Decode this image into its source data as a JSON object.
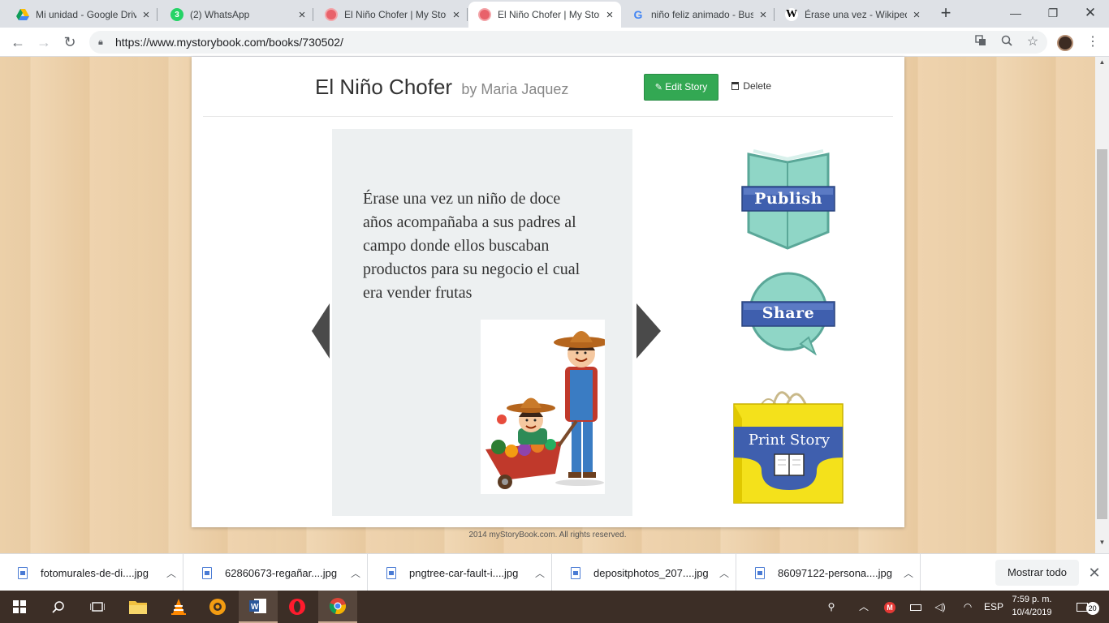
{
  "browser": {
    "tabs": [
      {
        "title": "Mi unidad - Google Drive",
        "favicon": "google-drive-icon",
        "active": false
      },
      {
        "title": "(2) WhatsApp",
        "favicon": "whatsapp-icon",
        "badge": "3",
        "active": false
      },
      {
        "title": "El Niño Chofer | My Story",
        "favicon": "mystorybook-icon",
        "active": false
      },
      {
        "title": "El Niño Chofer | My Story",
        "favicon": "mystorybook-icon",
        "active": true
      },
      {
        "title": "niño feliz animado - Buscar",
        "favicon": "google-icon",
        "active": false
      },
      {
        "title": "Érase una vez - Wikipedia",
        "favicon": "wikipedia-icon",
        "active": false
      }
    ],
    "new_tab": "+",
    "url": "https://www.mystorybook.com/books/730502/"
  },
  "story": {
    "title": "El Niño Chofer",
    "author_prefix": "by",
    "author": "Maria Jaquez",
    "edit_label": "Edit Story",
    "delete_label": "Delete",
    "page_text": "Érase una vez un niño de doce años acompañaba a sus padres al campo donde ellos buscaban productos para su negocio el cual era vender frutas",
    "actions": {
      "publish": "Publish",
      "share": "Share",
      "print": "Print Story"
    },
    "footer": "2014 myStoryBook.com. All rights reserved."
  },
  "downloads": {
    "items": [
      "fotomurales-de-di....jpg",
      "62860673-regañar....jpg",
      "pngtree-car-fault-i....jpg",
      "depositphotos_207....jpg",
      "86097122-persona....jpg"
    ],
    "show_all": "Mostrar todo"
  },
  "taskbar": {
    "language": "ESP",
    "time": "7:59 p. m.",
    "date": "10/4/2019",
    "notifications": "20"
  },
  "colors": {
    "edit_button": "#33a853",
    "publish_teal": "#78c8b8",
    "ribbon_blue": "#3f5fae",
    "print_yellow": "#f4e11b",
    "taskbar": "#3c2e26"
  }
}
